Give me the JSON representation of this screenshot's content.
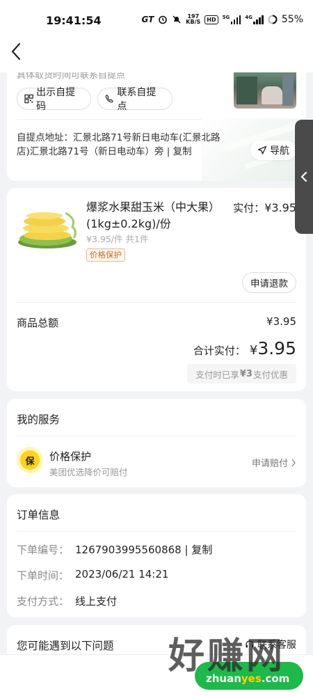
{
  "status_bar": {
    "time": "19:41:54",
    "carrier_mark": "GT",
    "net_speed_value": "197",
    "net_speed_unit": "KB/S",
    "hd_label": "HD",
    "signal1_label": "5G",
    "signal2_label": "4G",
    "battery": "55%"
  },
  "pickup": {
    "faded_text": "具体取货时间可联系自提点",
    "show_code_label": "出示自提码",
    "contact_label": "联系自提点",
    "address_prefix": "自提点地址：",
    "address": "汇景北路71号新日电动车(汇景北路店)汇景北路71号（新日电动车）旁",
    "separator": "|",
    "copy_label": "复制",
    "navigate_label": "导航"
  },
  "goods": {
    "name": "爆浆水果甜玉米（中大果）(1kg±0.2kg)/份",
    "paid_label": "实付：",
    "paid_value": "¥3.95",
    "unit_price": "¥3.95/件",
    "quantity": "共1件",
    "tag": "价格保护",
    "refund_label": "申请退款",
    "total_label": "商品总额",
    "total_value": "¥3.95",
    "sum_label": "合计实付：",
    "sum_currency": "¥",
    "sum_amount": "3.95",
    "discount_prefix": "支付时已享",
    "discount_value": "¥3",
    "discount_suffix": "支付优惠"
  },
  "service": {
    "title": "我的服务",
    "icon_char": "保",
    "item_title": "价格保护",
    "item_sub": "美团优选降价可赔付",
    "action_label": "申请赔付"
  },
  "order": {
    "title": "订单信息",
    "rows": [
      {
        "key": "下单编号：",
        "value": "1267903995560868 | 复制"
      },
      {
        "key": "下单时间：",
        "value": "2023/06/21 14:21"
      },
      {
        "key": "支付方式：",
        "value": "线上支付"
      }
    ]
  },
  "issues": {
    "title": "您可能遇到以下问题",
    "contact_label": "联系客服"
  },
  "watermark": {
    "cn": "好赚网",
    "en_pre": "zhuan",
    "en_mid": "yes",
    "en_post": ".com"
  },
  "colors": {
    "accent_green": "#1fb84a",
    "badge_yellow": "#ffd21e",
    "tag_orange": "#c26b2b"
  }
}
